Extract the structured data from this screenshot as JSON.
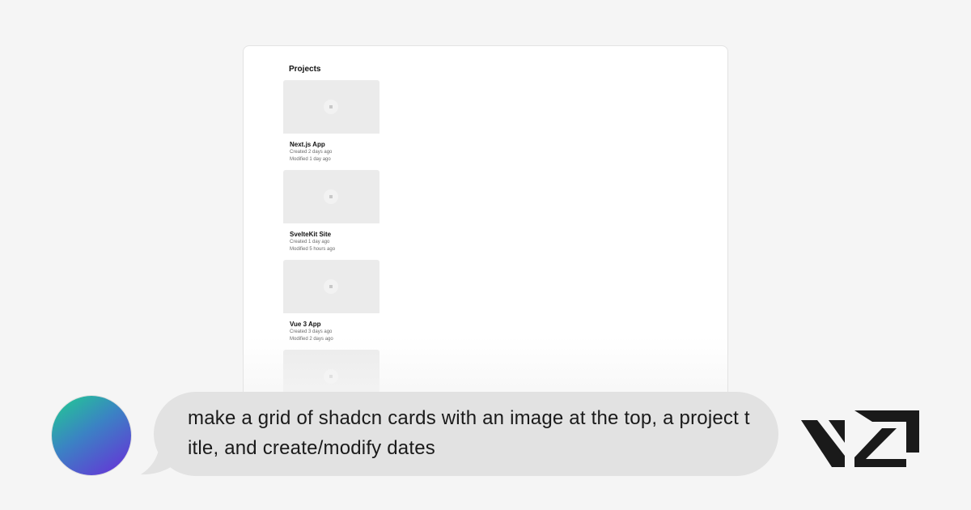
{
  "preview": {
    "panel_title": "Projects",
    "cards": [
      {
        "title": "Next.js App",
        "created": "Created 2 days ago",
        "modified": "Modified 1 day ago"
      },
      {
        "title": "SvelteKit Site",
        "created": "Created 1 day ago",
        "modified": "Modified 5 hours ago"
      },
      {
        "title": "Vue 3 App",
        "created": "Created 3 days ago",
        "modified": "Modified 2 days ago"
      },
      {
        "title": "",
        "created": "",
        "modified": ""
      }
    ]
  },
  "chat": {
    "message": "make a grid of shadcn cards with an image at the top, a project title, and create/modify dates"
  },
  "brand": {
    "logo": "v0-logo"
  },
  "colors": {
    "background": "#f5f5f5",
    "bubble": "#e2e2e2",
    "avatar_gradient_start": "#1fcf8f",
    "avatar_gradient_end": "#6a2bd9",
    "logo": "#1a1a1a"
  }
}
